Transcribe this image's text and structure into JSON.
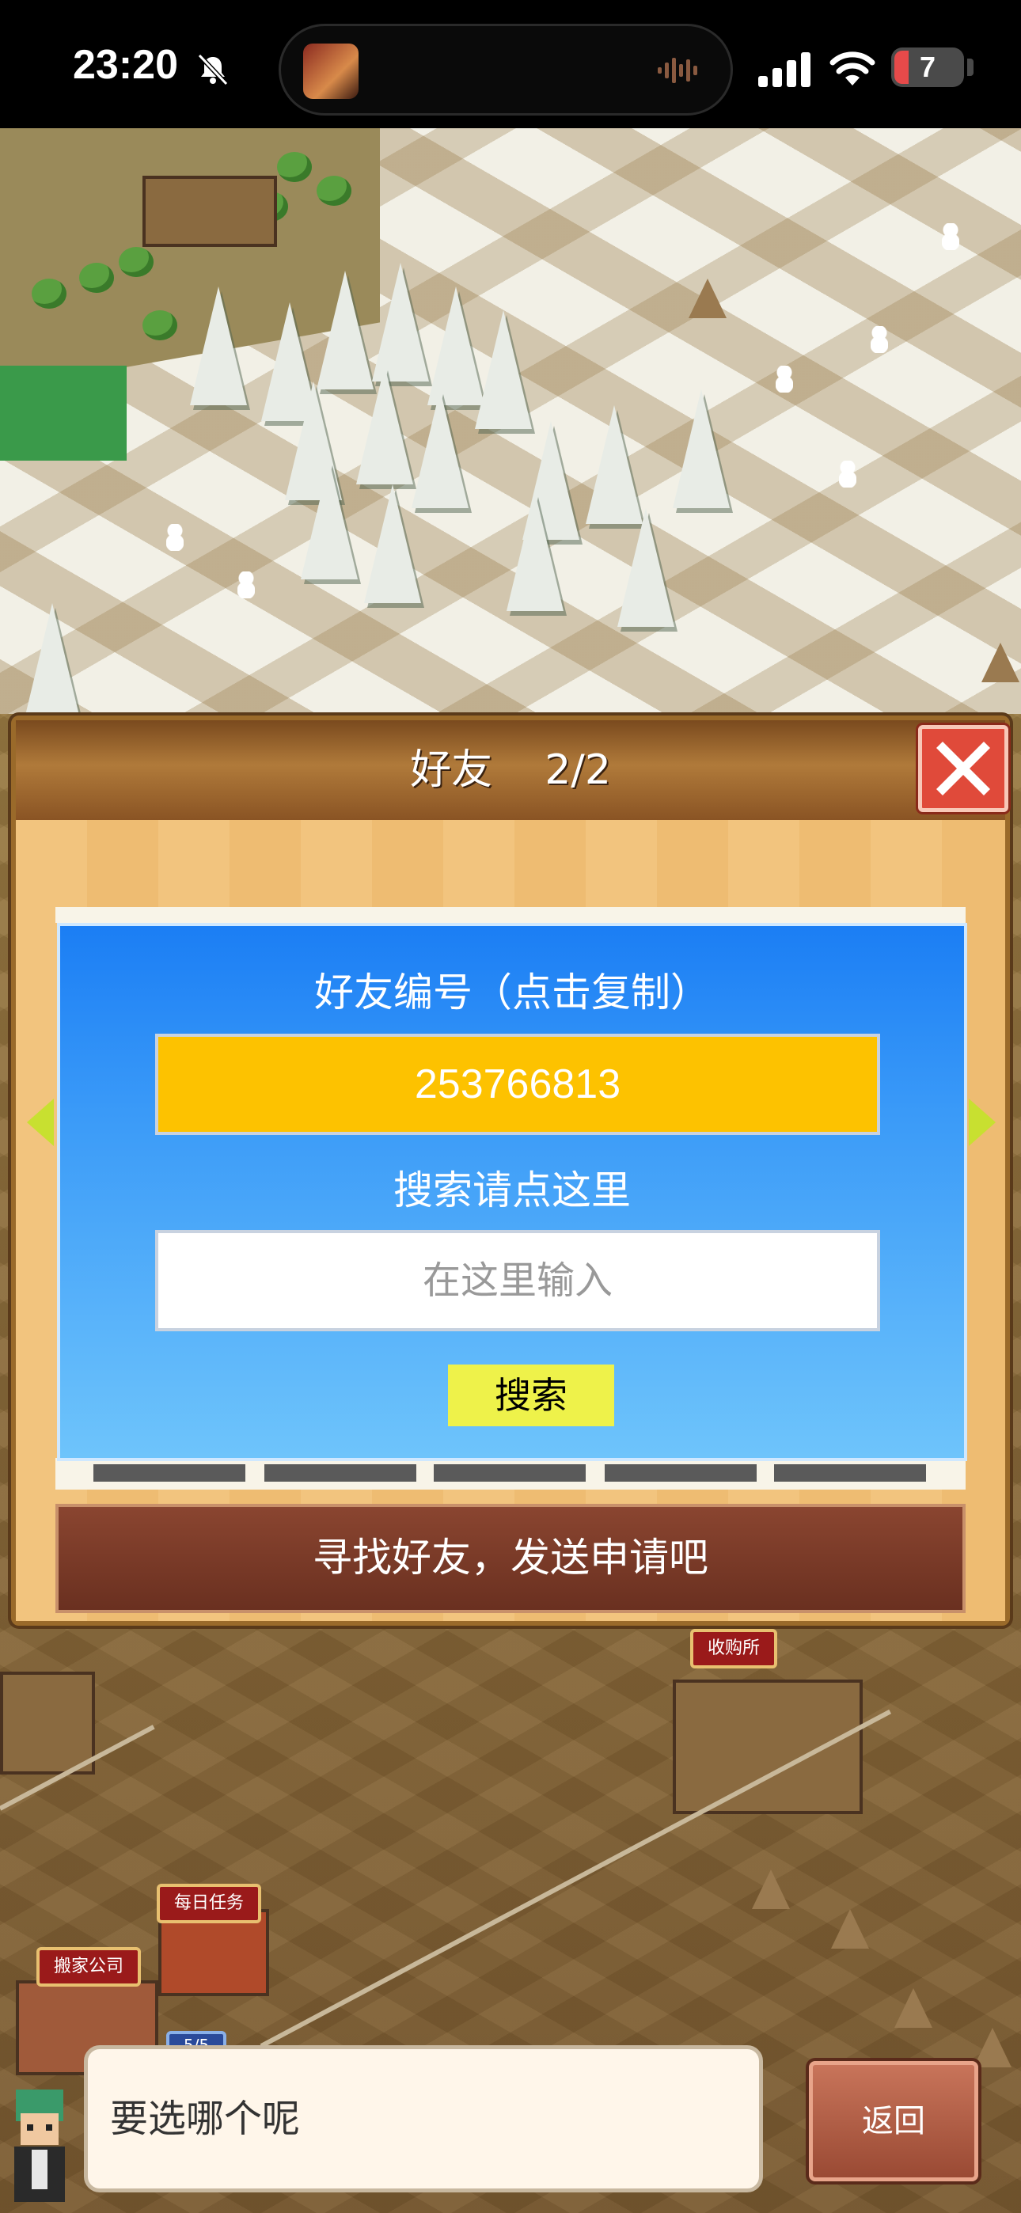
{
  "status_bar": {
    "time": "23:20",
    "battery_level": "7",
    "icons": [
      "bell-slash-icon",
      "audio-waveform-icon",
      "cellular-signal-icon",
      "wifi-icon",
      "battery-icon"
    ]
  },
  "map": {
    "signs": {
      "shop": "收购所",
      "daily_tasks": "每日任务",
      "moving_company": "搬家公司",
      "counter": "5/5"
    }
  },
  "dialog": {
    "title": "好友    2/2",
    "friend_id_label": "好友编号（点击复制）",
    "friend_id_value": "253766813",
    "search_label": "搜索请点这里",
    "search_placeholder": "在这里输入",
    "search_button": "搜索",
    "find_friends_banner": "寻找好友，发送申请吧"
  },
  "bottom_bar": {
    "speech_text": "要选哪个呢",
    "back_button": "返回"
  },
  "colors": {
    "dialog_bg": "#f0c27a",
    "panel_blue_top": "#1b7ef4",
    "friend_id_bg": "#fdc200",
    "search_button_bg": "#eef24a",
    "close_button_bg": "#e04a3a",
    "banner_bg": "#7a3a26"
  }
}
